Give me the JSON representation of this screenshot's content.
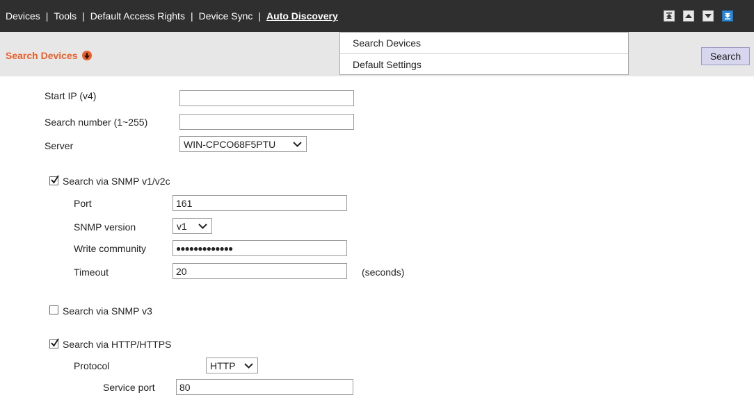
{
  "menu": {
    "items": [
      "Devices",
      "Tools",
      "Default Access Rights",
      "Device Sync",
      "Auto Discovery"
    ],
    "active": "Auto Discovery",
    "separator": "|"
  },
  "dropdown": {
    "items": [
      "Search Devices",
      "Default Settings"
    ]
  },
  "subheader": {
    "title": "Search Devices",
    "search_button": "Search",
    "accent_color": "#e8612c"
  },
  "form": {
    "start_ip": {
      "label": "Start IP (v4)",
      "value": ""
    },
    "search_number": {
      "label": "Search number (1~255)",
      "value": ""
    },
    "server": {
      "label": "Server",
      "value": "WIN-CPCO68F5PTU"
    },
    "snmp_v1": {
      "label": "Search via SNMP v1/v2c",
      "checked": true,
      "port": {
        "label": "Port",
        "value": "161"
      },
      "version": {
        "label": "SNMP version",
        "value": "v1"
      },
      "community": {
        "label": "Write community",
        "value": "●●●●●●●●●●●●●"
      },
      "timeout": {
        "label": "Timeout",
        "value": "20",
        "unit": "(seconds)"
      }
    },
    "snmp_v3": {
      "label": "Search via SNMP v3",
      "checked": false
    },
    "http": {
      "label": "Search via HTTP/HTTPS",
      "checked": true,
      "protocol": {
        "label": "Protocol",
        "value": "HTTP"
      },
      "service_port": {
        "label": "Service port",
        "value": "80"
      }
    }
  },
  "icons": {
    "nav": [
      "move-top-icon",
      "move-up-icon",
      "move-down-icon",
      "move-bottom-icon"
    ]
  }
}
